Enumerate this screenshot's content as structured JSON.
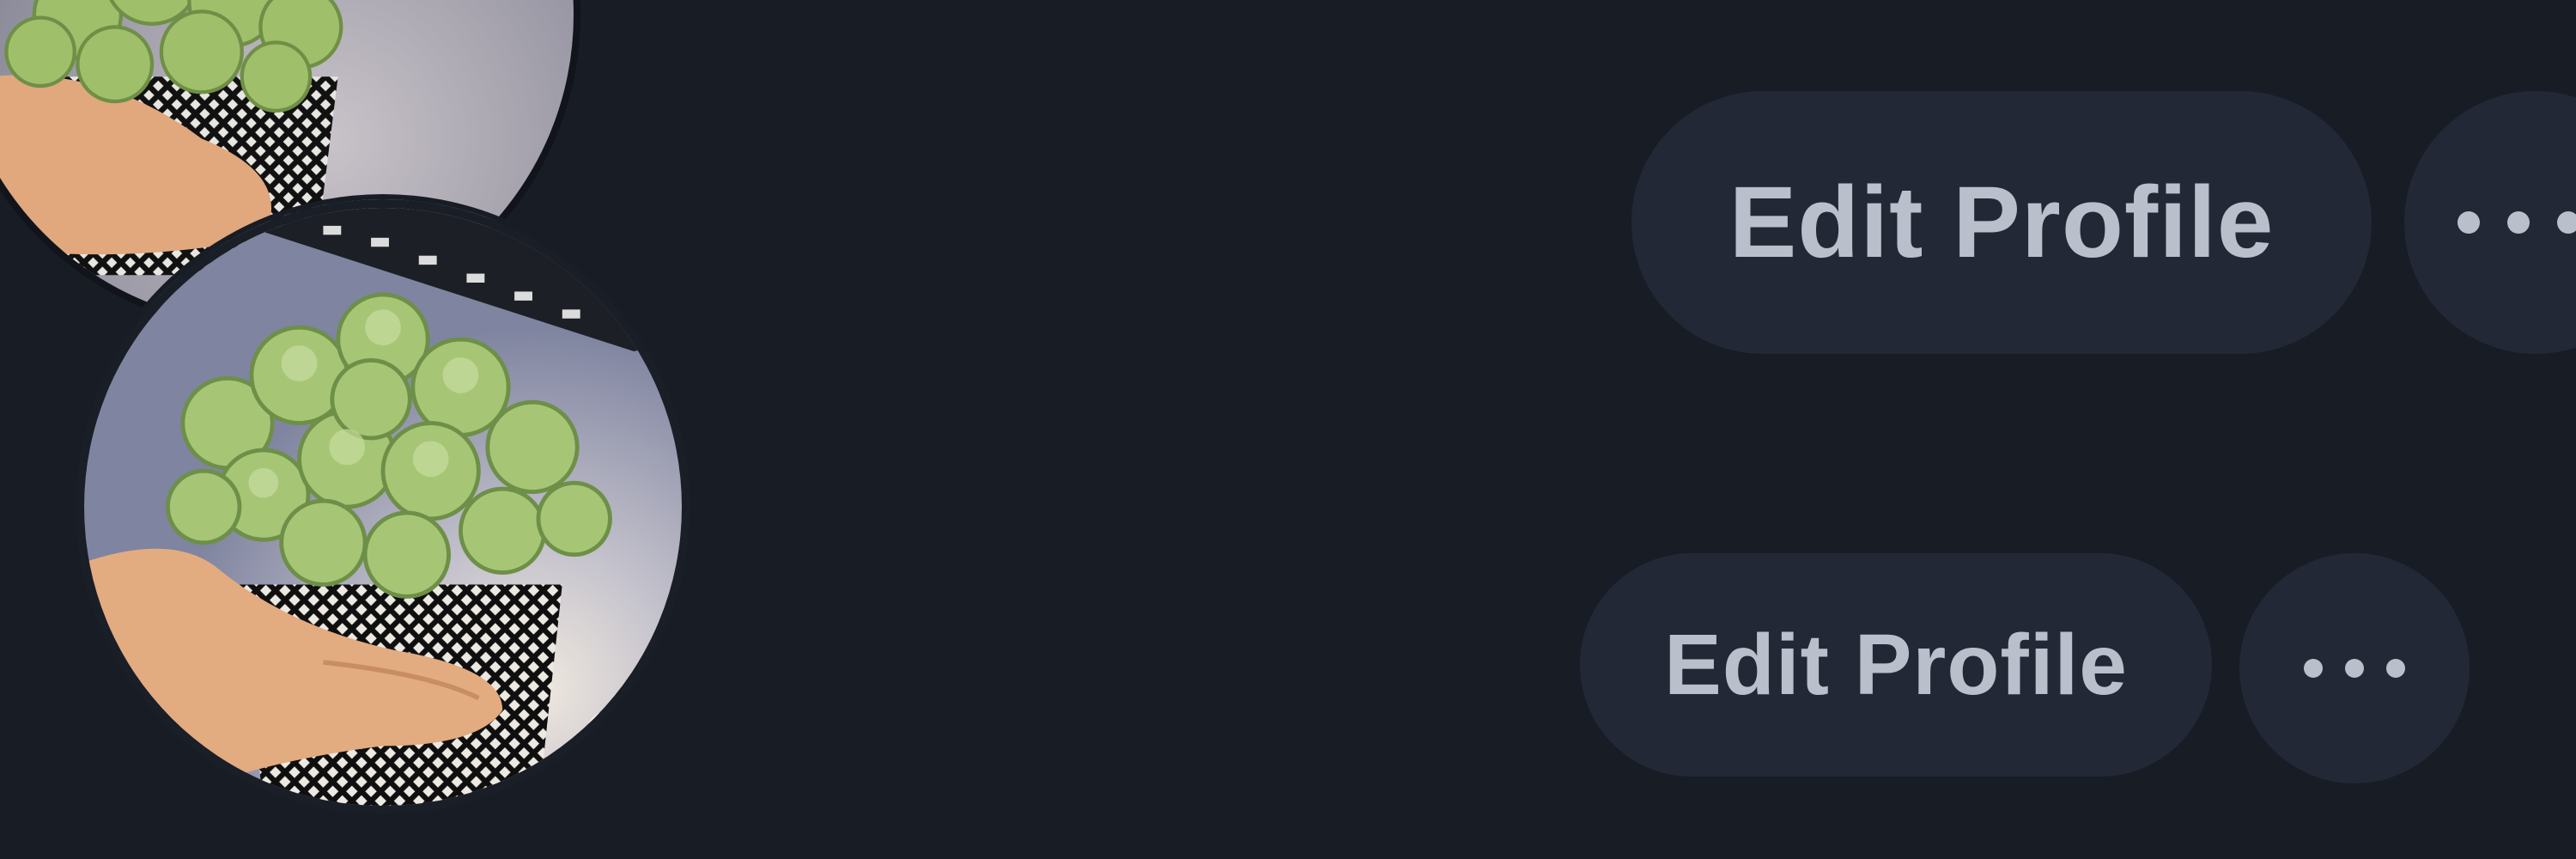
{
  "profile": {
    "avatar_alt": "succulent plant in hand"
  },
  "actions_large": {
    "edit_label": "Edit Profile",
    "more_icon": "more-horizontal-icon"
  },
  "actions_small": {
    "edit_label": "Edit Profile",
    "more_icon": "more-horizontal-icon"
  },
  "colors": {
    "background": "#181c25",
    "button_bg": "#232836",
    "button_text": "#b9c0cb"
  }
}
